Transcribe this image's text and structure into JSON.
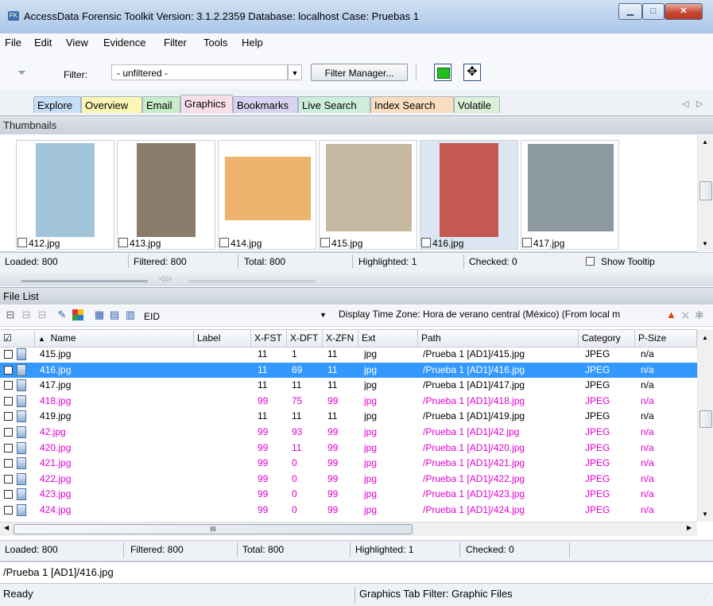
{
  "window": {
    "title": "AccessData Forensic Toolkit Version: 3.1.2.2359 Database: localhost Case: Pruebas 1"
  },
  "menu": [
    "File",
    "Edit",
    "View",
    "Evidence",
    "Filter",
    "Tools",
    "Help"
  ],
  "toolbar": {
    "filter_label": "Filter:",
    "filter_value": "- unfiltered -",
    "filter_manager": "Filter Manager..."
  },
  "tabs": [
    {
      "label": "Explore",
      "color": "#c6def6"
    },
    {
      "label": "Overview",
      "color": "#fbf6b5"
    },
    {
      "label": "Email",
      "color": "#c8ecc8"
    },
    {
      "label": "Graphics",
      "color": "#f7dfe9"
    },
    {
      "label": "Bookmarks",
      "color": "#d8d3f2"
    },
    {
      "label": "Live Search",
      "color": "#cdeedd"
    },
    {
      "label": "Index Search",
      "color": "#f8ddc1"
    },
    {
      "label": "Volatile",
      "color": "#dcefd8"
    }
  ],
  "thumbnails": {
    "header": "Thumbnails",
    "items": [
      {
        "name": "412.jpg",
        "bg": "#8bb6d1"
      },
      {
        "name": "413.jpg",
        "bg": "#6d5a45"
      },
      {
        "name": "414.jpg",
        "bg": "#e9a04b"
      },
      {
        "name": "415.jpg",
        "bg": "#b8a68a"
      },
      {
        "name": "416.jpg",
        "bg": "#c0352b"
      },
      {
        "name": "417.jpg",
        "bg": "#6f7f89"
      }
    ],
    "status": {
      "loaded": "Loaded: 800",
      "filtered": "Filtered: 800",
      "total": "Total: 800",
      "highlighted": "Highlighted: 1",
      "checked": "Checked: 0",
      "tooltip": "Show Tooltip"
    }
  },
  "filelist": {
    "header": "File List",
    "column_select": "EID",
    "timezone": "Display Time Zone: Hora de verano central (México)  (From local m",
    "columns": [
      "Name",
      "Label",
      "X-FST",
      "X-DFT",
      "X-ZFN",
      "Ext",
      "Path",
      "Category",
      "P-Size"
    ],
    "rows": [
      {
        "name": "415.jpg",
        "fst": "11",
        "dft": "1",
        "zfn": "11",
        "ext": "jpg",
        "path": "/Prueba 1 [AD1]/415.jpg",
        "cat": "JPEG",
        "psize": "n/a",
        "style": ""
      },
      {
        "name": "416.jpg",
        "fst": "11",
        "dft": "69",
        "zfn": "11",
        "ext": "jpg",
        "path": "/Prueba 1 [AD1]/416.jpg",
        "cat": "JPEG",
        "psize": "n/a",
        "style": "sel"
      },
      {
        "name": "417.jpg",
        "fst": "11",
        "dft": "11",
        "zfn": "11",
        "ext": "jpg",
        "path": "/Prueba 1 [AD1]/417.jpg",
        "cat": "JPEG",
        "psize": "n/a",
        "style": ""
      },
      {
        "name": "418.jpg",
        "fst": "99",
        "dft": "75",
        "zfn": "99",
        "ext": "jpg",
        "path": "/Prueba 1 [AD1]/418.jpg",
        "cat": "JPEG",
        "psize": "n/a",
        "style": "pink"
      },
      {
        "name": "419.jpg",
        "fst": "11",
        "dft": "11",
        "zfn": "11",
        "ext": "jpg",
        "path": "/Prueba 1 [AD1]/419.jpg",
        "cat": "JPEG",
        "psize": "n/a",
        "style": ""
      },
      {
        "name": "42.jpg",
        "fst": "99",
        "dft": "93",
        "zfn": "99",
        "ext": "jpg",
        "path": "/Prueba 1 [AD1]/42.jpg",
        "cat": "JPEG",
        "psize": "n/a",
        "style": "pink"
      },
      {
        "name": "420.jpg",
        "fst": "99",
        "dft": "11",
        "zfn": "99",
        "ext": "jpg",
        "path": "/Prueba 1 [AD1]/420.jpg",
        "cat": "JPEG",
        "psize": "n/a",
        "style": "pink"
      },
      {
        "name": "421.jpg",
        "fst": "99",
        "dft": "0",
        "zfn": "99",
        "ext": "jpg",
        "path": "/Prueba 1 [AD1]/421.jpg",
        "cat": "JPEG",
        "psize": "n/a",
        "style": "pink"
      },
      {
        "name": "422.jpg",
        "fst": "99",
        "dft": "0",
        "zfn": "99",
        "ext": "jpg",
        "path": "/Prueba 1 [AD1]/422.jpg",
        "cat": "JPEG",
        "psize": "n/a",
        "style": "pink"
      },
      {
        "name": "423.jpg",
        "fst": "99",
        "dft": "0",
        "zfn": "99",
        "ext": "jpg",
        "path": "/Prueba 1 [AD1]/423.jpg",
        "cat": "JPEG",
        "psize": "n/a",
        "style": "pink"
      },
      {
        "name": "424.jpg",
        "fst": "99",
        "dft": "0",
        "zfn": "99",
        "ext": "jpg",
        "path": "/Prueba 1 [AD1]/424.jpg",
        "cat": "JPEG",
        "psize": "n/a",
        "style": "pink"
      }
    ],
    "hscroll_label": "III",
    "status": {
      "loaded": "Loaded: 800",
      "filtered": "Filtered: 800",
      "total": "Total: 800",
      "highlighted": "Highlighted: 1",
      "checked": "Checked: 0"
    }
  },
  "path": "/Prueba 1 [AD1]/416.jpg",
  "statusbar": {
    "left": "Ready",
    "right": "Graphics Tab Filter: Graphic Files"
  }
}
